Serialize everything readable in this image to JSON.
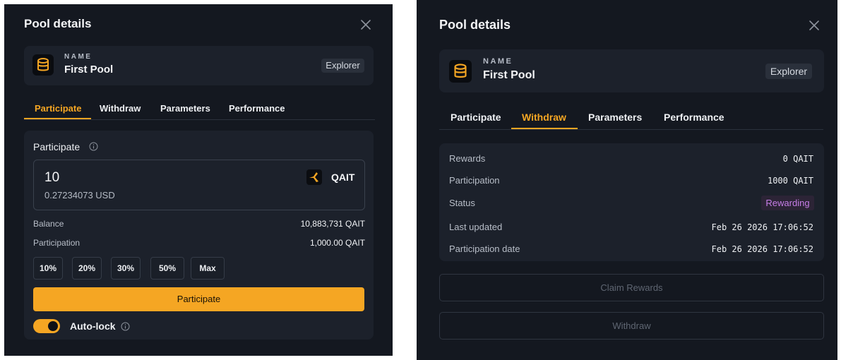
{
  "panels": [
    {
      "title": "Pool details",
      "name_label": "NAME",
      "name_value": "First Pool",
      "explorer_label": "Explorer",
      "tabs": [
        "Participate",
        "Withdraw",
        "Parameters",
        "Performance"
      ],
      "active_tab": "Participate",
      "participate": {
        "section_title": "Participate",
        "amount": "10",
        "usd_value": "0.27234073 USD",
        "token": "QAIT",
        "rows": [
          {
            "label": "Balance",
            "value": "10,883,731 QAIT"
          },
          {
            "label": "Participation",
            "value": "1,000.00 QAIT"
          }
        ],
        "percent_buttons": [
          "10%",
          "20%",
          "30%",
          "50%",
          "Max"
        ],
        "submit_label": "Participate",
        "autolock_label": "Auto-lock",
        "autolock_on": true
      }
    },
    {
      "title": "Pool details",
      "name_label": "NAME",
      "name_value": "First Pool",
      "explorer_label": "Explorer",
      "tabs": [
        "Participate",
        "Withdraw",
        "Parameters",
        "Performance"
      ],
      "active_tab": "Withdraw",
      "withdraw": {
        "rows": [
          {
            "label": "Rewards",
            "value": "0 QAIT"
          },
          {
            "label": "Participation",
            "value": "1000 QAIT"
          },
          {
            "label": "Status",
            "value": "Rewarding"
          },
          {
            "label": "Last updated",
            "value": "Feb 26 2026 17:06:52"
          },
          {
            "label": "Participation date",
            "value": "Feb 26 2026 17:06:52"
          }
        ],
        "claim_label": "Claim Rewards",
        "withdraw_label": "Withdraw"
      }
    }
  ],
  "colors": {
    "accent": "#f5a623",
    "panel_bg": "#141820",
    "card_bg": "#1c212b",
    "status_rewarding": "#c77ee8"
  },
  "icons": {
    "close": "close-icon",
    "database": "database-icon",
    "info": "info-icon",
    "token": "qait-token-icon"
  }
}
